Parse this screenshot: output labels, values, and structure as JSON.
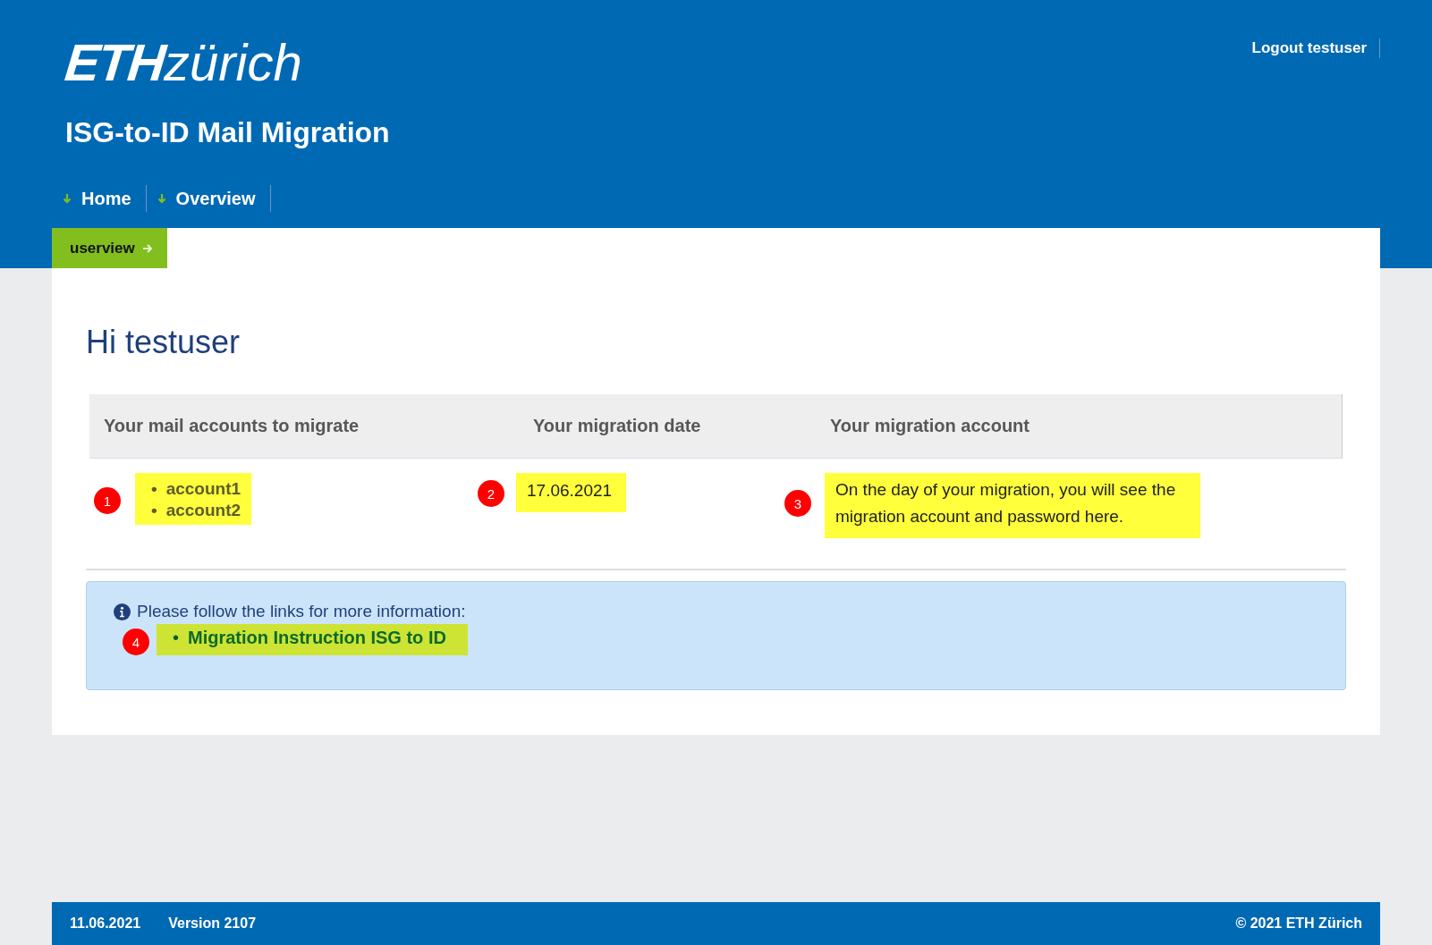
{
  "logo": {
    "bold": "ETH",
    "light": "zürich"
  },
  "app_title": "ISG-to-ID Mail Migration",
  "user_link": "Logout testuser",
  "nav": [
    {
      "label": "Home"
    },
    {
      "label": "Overview"
    }
  ],
  "breadcrumb": "userview",
  "greeting": "Hi testuser",
  "table": {
    "columns": [
      "Your mail accounts to migrate",
      "Your migration date",
      "Your migration account"
    ],
    "cells": [
      {
        "kind": "list",
        "marker": "1",
        "color": "#ffff3c",
        "items": [
          {
            "bullet": "•",
            "text": "account1"
          },
          {
            "bullet": "•",
            "text": "account2"
          }
        ]
      },
      {
        "kind": "text",
        "marker": "2",
        "color": "#ffff3c",
        "text": "17.06.2021"
      },
      {
        "kind": "text",
        "marker": "3",
        "color": "#ffff3c",
        "text": "On the day of your migration, you will see the migration account and password here."
      }
    ]
  },
  "info": {
    "text": "Please follow the links for more information:",
    "links": [
      {
        "bullet": "•",
        "label": "Migration Instruction ISG to ID",
        "marker": "4",
        "color": "#cde434"
      }
    ]
  },
  "footer": {
    "date": "11.06.2021",
    "version": "Version 2107",
    "copyright": "© 2021 ETH Zürich"
  }
}
